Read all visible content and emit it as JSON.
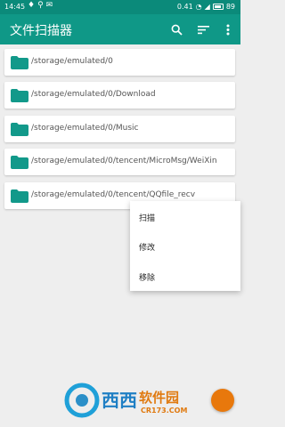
{
  "status_bar": {
    "time": "14:45",
    "speed": "0.41",
    "battery": "89"
  },
  "app_bar": {
    "title": "文件扫描器"
  },
  "folders": [
    {
      "path": "/storage/emulated/0"
    },
    {
      "path": "/storage/emulated/0/Download"
    },
    {
      "path": "/storage/emulated/0/Music"
    },
    {
      "path": "/storage/emulated/0/tencent/MicroMsg/WeiXin"
    },
    {
      "path": "/storage/emulated/0/tencent/QQfile_recv"
    }
  ],
  "context_menu": {
    "items": [
      {
        "label": "扫描"
      },
      {
        "label": "修改"
      },
      {
        "label": "移除"
      }
    ]
  },
  "watermark": {
    "brand": "西西软件园",
    "url": "CR173.COM"
  },
  "colors": {
    "status_bar": "#0b8a7a",
    "app_bar": "#0f9887",
    "folder": "#12998a",
    "background": "#eeeeee"
  },
  "icons": {
    "search": "search-icon",
    "sort": "sort-icon",
    "overflow": "more-vert-icon",
    "folder": "folder-icon"
  }
}
